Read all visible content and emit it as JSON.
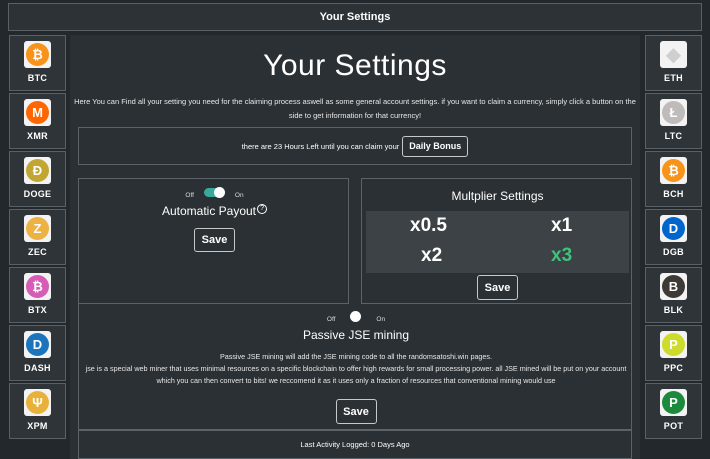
{
  "header": {
    "title": "Your Settings"
  },
  "left_coins": [
    {
      "label": "BTC",
      "icon": "bitcoin-icon",
      "glyph": "₿",
      "color": "#f7931a"
    },
    {
      "label": "XMR",
      "icon": "monero-icon",
      "glyph": "M",
      "color": "#ff6600"
    },
    {
      "label": "DOGE",
      "icon": "dogecoin-icon",
      "glyph": "Ð",
      "color": "#c2a633"
    },
    {
      "label": "ZEC",
      "icon": "zcash-icon",
      "glyph": "Z",
      "color": "#ecb244"
    },
    {
      "label": "BTX",
      "icon": "bitcore-icon",
      "glyph": "₿",
      "color": "#d65db5"
    },
    {
      "label": "DASH",
      "icon": "dash-icon",
      "glyph": "D",
      "color": "#1c75bc"
    },
    {
      "label": "XPM",
      "icon": "primecoin-icon",
      "glyph": "Ψ",
      "color": "#e8b23a"
    }
  ],
  "right_coins": [
    {
      "label": "ETH",
      "icon": "ethereum-icon",
      "glyph": "◆",
      "color": "#2e3438"
    },
    {
      "label": "LTC",
      "icon": "litecoin-icon",
      "glyph": "Ł",
      "color": "#bfbbbb"
    },
    {
      "label": "BCH",
      "icon": "bitcoin-cash-icon",
      "glyph": "₿",
      "color": "#f7931a"
    },
    {
      "label": "DGB",
      "icon": "digibyte-icon",
      "glyph": "D",
      "color": "#0066cc"
    },
    {
      "label": "BLK",
      "icon": "blackcoin-icon",
      "glyph": "B",
      "color": "#3d3a36"
    },
    {
      "label": "PPC",
      "icon": "peercoin-icon",
      "glyph": "P",
      "color": "#cddb2a"
    },
    {
      "label": "POT",
      "icon": "potcoin-icon",
      "glyph": "P",
      "color": "#1b8a3c"
    }
  ],
  "main": {
    "title": "Your Settings",
    "intro": "Here You can Find all your setting you need for the claiming process aswell as some general account settings. if you want to claim a currency, simply click a button on the side to get information for that currency!",
    "bonus_text": "there are 23 Hours Left until you can claim your",
    "bonus_button": "Daily Bonus",
    "payout": {
      "off": "Off",
      "on": "On",
      "title": "Automatic Payout",
      "help_icon": "question-circle-icon",
      "save": "Save",
      "enabled": true
    },
    "multiplier": {
      "title": "Multplier Settings",
      "options": [
        "x0.5",
        "x1",
        "x2",
        "x3"
      ],
      "selected": "x3",
      "selected_color": "#3fc27a",
      "save": "Save"
    },
    "jse": {
      "off": "Off",
      "on": "On",
      "enabled": false,
      "title": "Passive JSE mining",
      "line1": "Passive JSE mining will add the JSE mining code to all the randomsatoshi.win pages.",
      "line2": "jse is a special web miner that uses minimal resources on a specific blockchain to offer high rewards for small processing power. all JSE mined will be put on your account which you can then convert to bits! we reccomend it as it uses only a fraction of resources that conventional mining would use",
      "save": "Save"
    },
    "footer": "Last Activity Logged: 0 Days Ago"
  }
}
